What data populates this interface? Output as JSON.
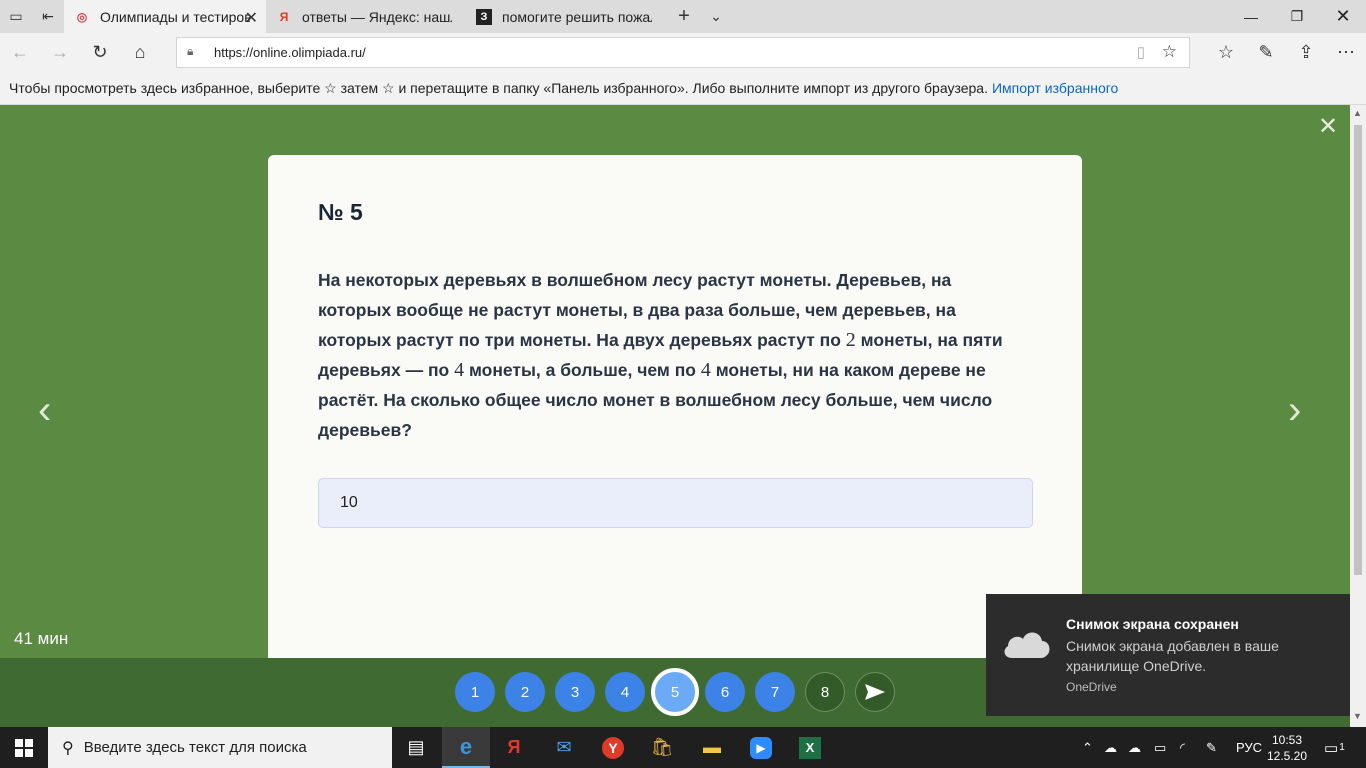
{
  "browser": {
    "tabs": [
      {
        "title": "Олимпиады и тестирова",
        "active": true
      },
      {
        "title": "ответы — Яндекс: нашлось",
        "active": false
      },
      {
        "title": "помогите решить пожалуй",
        "active": false
      }
    ],
    "url": "https://online.olimpiada.ru/",
    "favorites_bar": {
      "text": "Чтобы просмотреть здесь избранное, выберите ☆ затем ☆ и перетащите в папку «Панель избранного». Либо выполните импорт из другого браузера.",
      "link": "Импорт избранного"
    }
  },
  "task": {
    "number": "№ 5",
    "question_parts": [
      "На некоторых деревьях в волшебном лесу растут монеты. Деревьев, на которых вообще не растут монеты, в два раза больше, чем деревьев, на которых растут по три монеты. На двух деревьях растут по ",
      "2",
      " монеты, на пяти деревьях — по ",
      "4",
      " монеты, а больше, чем по ",
      "4",
      " монеты, ни на каком дереве не растёт. На сколько общее число монет в волшебном лесу больше, чем число деревьев?"
    ],
    "answer": "10",
    "timer": "41 мин"
  },
  "navigation": {
    "questions": [
      "1",
      "2",
      "3",
      "4",
      "5",
      "6",
      "7",
      "8"
    ],
    "current": "5",
    "send_icon": "send-icon"
  },
  "toast": {
    "title": "Снимок экрана сохранен",
    "body": "Снимок экрана добавлен в ваше хранилище OneDrive.",
    "source": "OneDrive"
  },
  "taskbar": {
    "search_placeholder": "Введите здесь текст для поиска",
    "language": "РУС",
    "time": "10:53",
    "date": "12.5.20",
    "notifications": "1"
  },
  "colors": {
    "page_bg": "#5b8a43",
    "nav_bg": "#3f6b32",
    "circle_blue": "#3d82e6",
    "link": "#0a66c2"
  }
}
